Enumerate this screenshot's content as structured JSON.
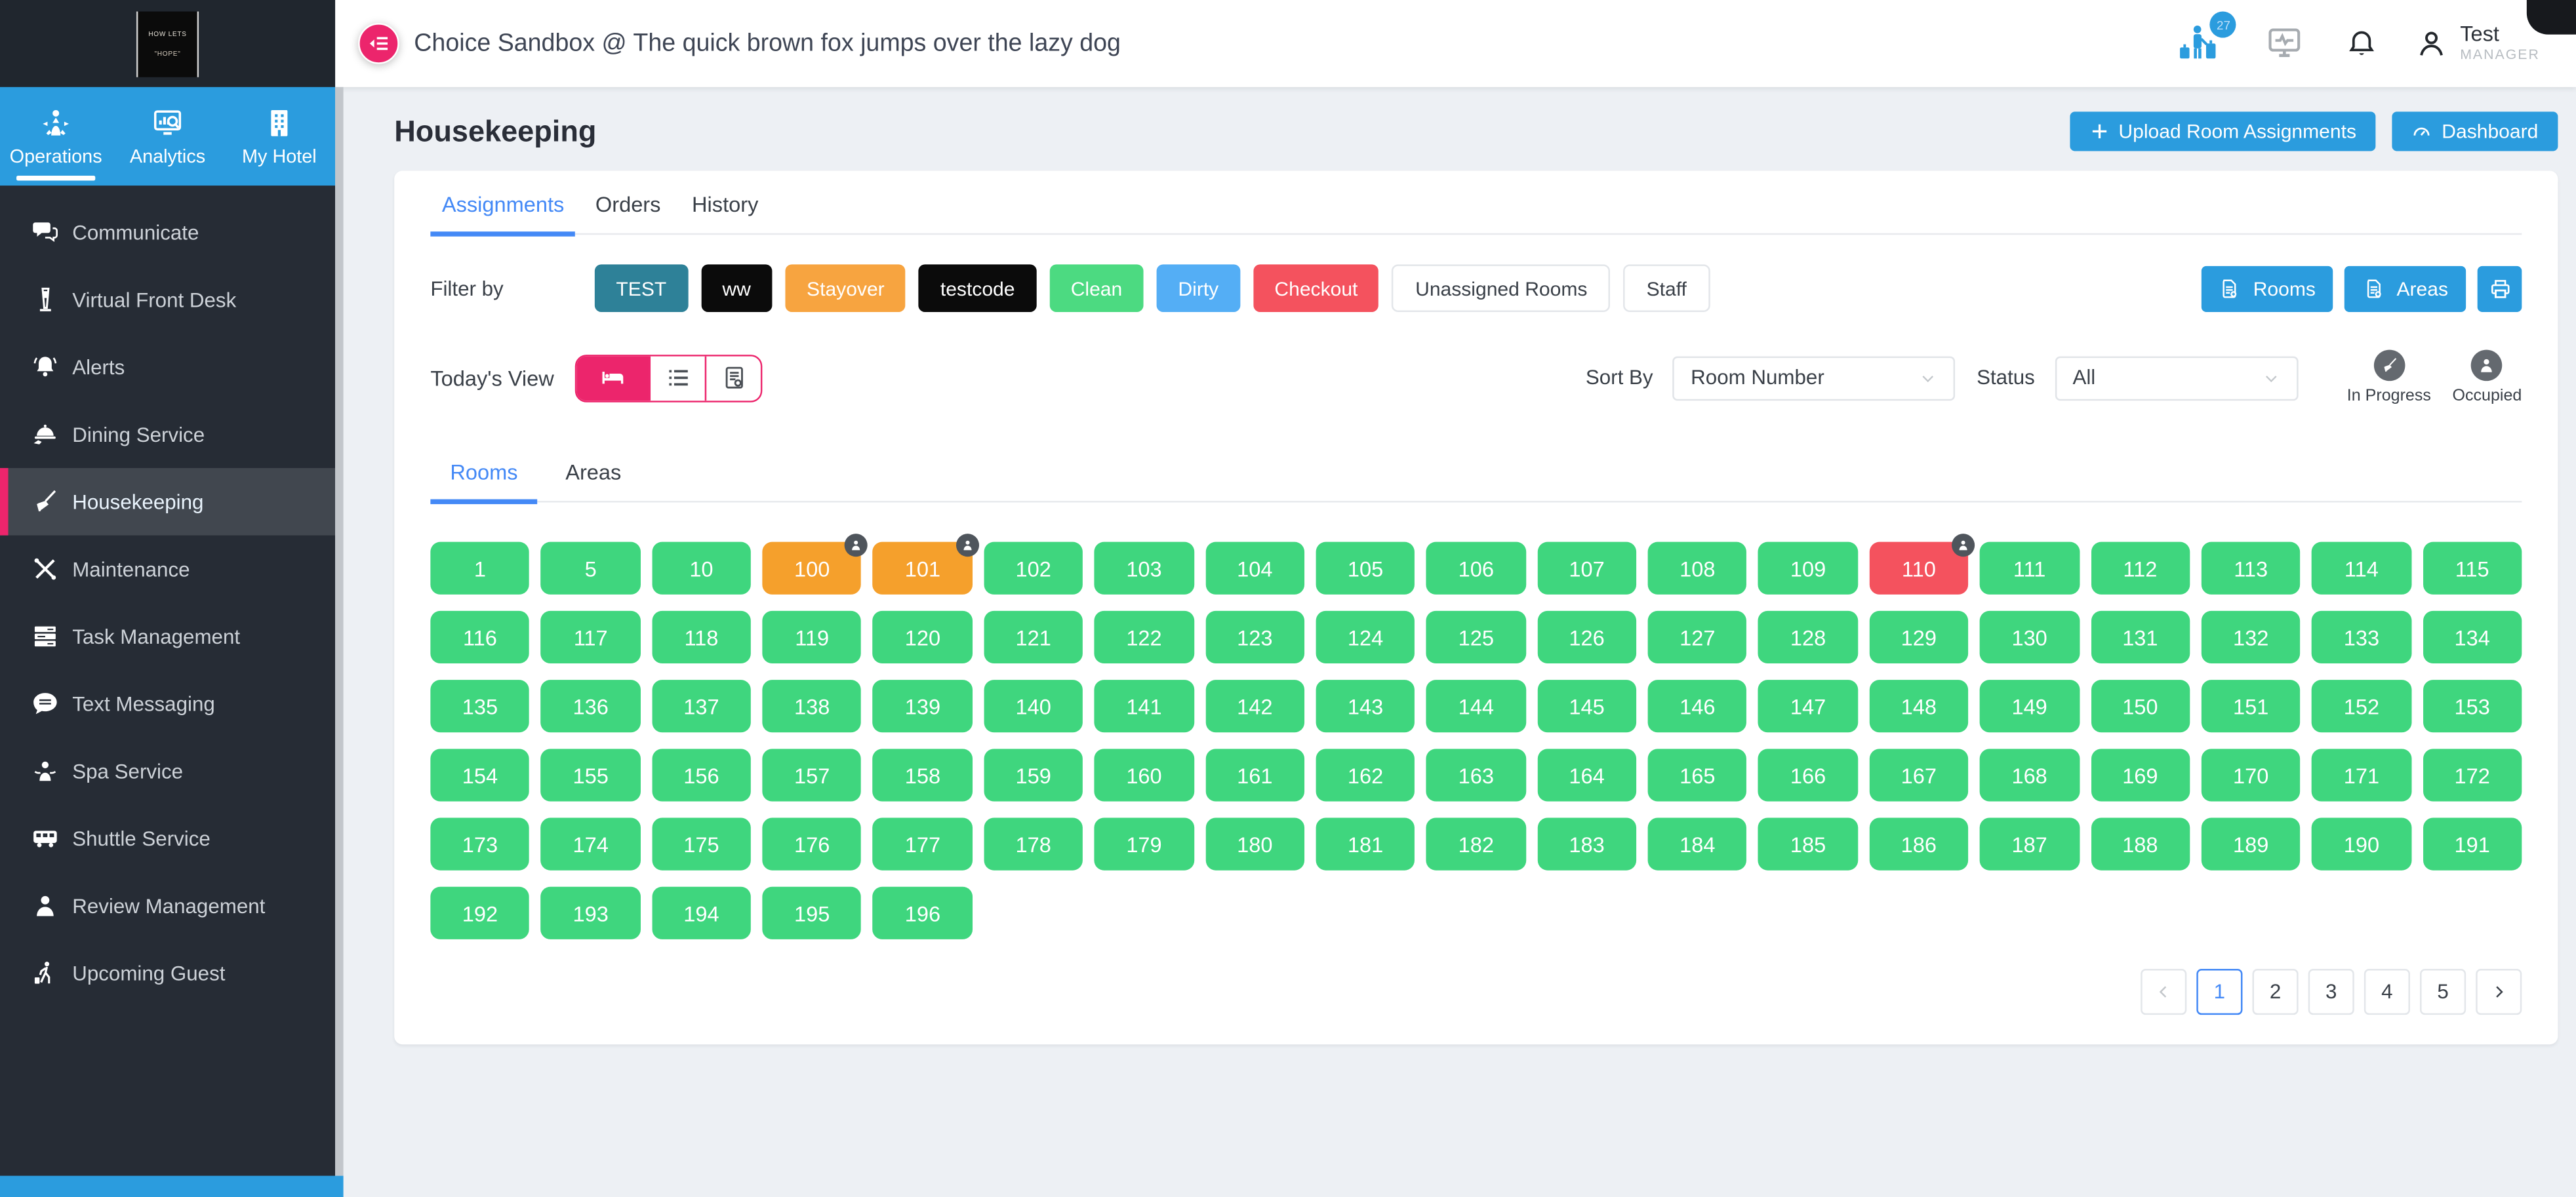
{
  "header": {
    "logo_line1": "HOW LETS",
    "logo_line2": "\"HOPE\"",
    "title": "Choice Sandbox @ The quick brown fox jumps over the lazy dog",
    "guest_badge": "27",
    "user_name": "Test",
    "user_role": "MANAGER"
  },
  "sidebar": {
    "tabs": [
      {
        "label": "Operations",
        "icon": "operations",
        "active": true
      },
      {
        "label": "Analytics",
        "icon": "analytics",
        "active": false
      },
      {
        "label": "My Hotel",
        "icon": "hotel",
        "active": false
      }
    ],
    "items": [
      {
        "label": "Communicate",
        "icon": "chat",
        "active": false
      },
      {
        "label": "Virtual Front Desk",
        "icon": "kiosk",
        "active": false
      },
      {
        "label": "Alerts",
        "icon": "bellring",
        "active": false
      },
      {
        "label": "Dining Service",
        "icon": "dining",
        "active": false
      },
      {
        "label": "Housekeeping",
        "icon": "broom",
        "active": true
      },
      {
        "label": "Maintenance",
        "icon": "tools",
        "active": false
      },
      {
        "label": "Task Management",
        "icon": "tasks",
        "active": false
      },
      {
        "label": "Text Messaging",
        "icon": "message",
        "active": false
      },
      {
        "label": "Spa Service",
        "icon": "spa",
        "active": false
      },
      {
        "label": "Shuttle Service",
        "icon": "bus",
        "active": false
      },
      {
        "label": "Review Management",
        "icon": "person",
        "active": false
      },
      {
        "label": "Upcoming Guest",
        "icon": "walker",
        "active": false
      }
    ]
  },
  "page": {
    "title": "Housekeeping",
    "upload_button": "Upload Room Assignments",
    "dashboard_button": "Dashboard"
  },
  "main_tabs": [
    {
      "label": "Assignments",
      "active": true
    },
    {
      "label": "Orders",
      "active": false
    },
    {
      "label": "History",
      "active": false
    }
  ],
  "filter": {
    "label": "Filter by",
    "chips": [
      {
        "label": "TEST",
        "bg": "#2E8198",
        "fg": "#FFFFFF"
      },
      {
        "label": "ww",
        "bg": "#0B0B0B",
        "fg": "#FFFFFF"
      },
      {
        "label": "Stayover",
        "bg": "#F7A440",
        "fg": "#FFFFFF"
      },
      {
        "label": "testcode",
        "bg": "#0B0B0B",
        "fg": "#FFFFFF"
      },
      {
        "label": "Clean",
        "bg": "#4CDA81",
        "fg": "#FFFFFF"
      },
      {
        "label": "Dirty",
        "bg": "#54AEF5",
        "fg": "#FFFFFF"
      },
      {
        "label": "Checkout",
        "bg": "#F4525E",
        "fg": "#FFFFFF"
      },
      {
        "label": "Unassigned Rooms",
        "bg": "#FFFFFF",
        "fg": "#3A4048"
      },
      {
        "label": "Staff",
        "bg": "#FFFFFF",
        "fg": "#3A4048"
      }
    ],
    "rooms_button": "Rooms",
    "areas_button": "Areas"
  },
  "toolbar": {
    "view_label": "Today's View",
    "sort_label": "Sort By",
    "sort_value": "Room Number",
    "status_label": "Status",
    "status_value": "All",
    "legend": [
      {
        "label": "In Progress",
        "icon": "broom"
      },
      {
        "label": "Occupied",
        "icon": "person"
      }
    ]
  },
  "sub_tabs": [
    {
      "label": "Rooms",
      "active": true
    },
    {
      "label": "Areas",
      "active": false
    }
  ],
  "status_colors": {
    "clean": "#3FD67E",
    "stayover": "#F5A02C",
    "checkout": "#F4525E"
  },
  "rooms": [
    [
      "1",
      "clean",
      0
    ],
    [
      "5",
      "clean",
      0
    ],
    [
      "10",
      "clean",
      0
    ],
    [
      "100",
      "stayover",
      1
    ],
    [
      "101",
      "stayover",
      1
    ],
    [
      "102",
      "clean",
      0
    ],
    [
      "103",
      "clean",
      0
    ],
    [
      "104",
      "clean",
      0
    ],
    [
      "105",
      "clean",
      0
    ],
    [
      "106",
      "clean",
      0
    ],
    [
      "107",
      "clean",
      0
    ],
    [
      "108",
      "clean",
      0
    ],
    [
      "109",
      "clean",
      0
    ],
    [
      "110",
      "checkout",
      1
    ],
    [
      "111",
      "clean",
      0
    ],
    [
      "112",
      "clean",
      0
    ],
    [
      "113",
      "clean",
      0
    ],
    [
      "114",
      "clean",
      0
    ],
    [
      "115",
      "clean",
      0
    ],
    [
      "116",
      "clean",
      0
    ],
    [
      "117",
      "clean",
      0
    ],
    [
      "118",
      "clean",
      0
    ],
    [
      "119",
      "clean",
      0
    ],
    [
      "120",
      "clean",
      0
    ],
    [
      "121",
      "clean",
      0
    ],
    [
      "122",
      "clean",
      0
    ],
    [
      "123",
      "clean",
      0
    ],
    [
      "124",
      "clean",
      0
    ],
    [
      "125",
      "clean",
      0
    ],
    [
      "126",
      "clean",
      0
    ],
    [
      "127",
      "clean",
      0
    ],
    [
      "128",
      "clean",
      0
    ],
    [
      "129",
      "clean",
      0
    ],
    [
      "130",
      "clean",
      0
    ],
    [
      "131",
      "clean",
      0
    ],
    [
      "132",
      "clean",
      0
    ],
    [
      "133",
      "clean",
      0
    ],
    [
      "134",
      "clean",
      0
    ],
    [
      "135",
      "clean",
      0
    ],
    [
      "136",
      "clean",
      0
    ],
    [
      "137",
      "clean",
      0
    ],
    [
      "138",
      "clean",
      0
    ],
    [
      "139",
      "clean",
      0
    ],
    [
      "140",
      "clean",
      0
    ],
    [
      "141",
      "clean",
      0
    ],
    [
      "142",
      "clean",
      0
    ],
    [
      "143",
      "clean",
      0
    ],
    [
      "144",
      "clean",
      0
    ],
    [
      "145",
      "clean",
      0
    ],
    [
      "146",
      "clean",
      0
    ],
    [
      "147",
      "clean",
      0
    ],
    [
      "148",
      "clean",
      0
    ],
    [
      "149",
      "clean",
      0
    ],
    [
      "150",
      "clean",
      0
    ],
    [
      "151",
      "clean",
      0
    ],
    [
      "152",
      "clean",
      0
    ],
    [
      "153",
      "clean",
      0
    ],
    [
      "154",
      "clean",
      0
    ],
    [
      "155",
      "clean",
      0
    ],
    [
      "156",
      "clean",
      0
    ],
    [
      "157",
      "clean",
      0
    ],
    [
      "158",
      "clean",
      0
    ],
    [
      "159",
      "clean",
      0
    ],
    [
      "160",
      "clean",
      0
    ],
    [
      "161",
      "clean",
      0
    ],
    [
      "162",
      "clean",
      0
    ],
    [
      "163",
      "clean",
      0
    ],
    [
      "164",
      "clean",
      0
    ],
    [
      "165",
      "clean",
      0
    ],
    [
      "166",
      "clean",
      0
    ],
    [
      "167",
      "clean",
      0
    ],
    [
      "168",
      "clean",
      0
    ],
    [
      "169",
      "clean",
      0
    ],
    [
      "170",
      "clean",
      0
    ],
    [
      "171",
      "clean",
      0
    ],
    [
      "172",
      "clean",
      0
    ],
    [
      "173",
      "clean",
      0
    ],
    [
      "174",
      "clean",
      0
    ],
    [
      "175",
      "clean",
      0
    ],
    [
      "176",
      "clean",
      0
    ],
    [
      "177",
      "clean",
      0
    ],
    [
      "178",
      "clean",
      0
    ],
    [
      "179",
      "clean",
      0
    ],
    [
      "180",
      "clean",
      0
    ],
    [
      "181",
      "clean",
      0
    ],
    [
      "182",
      "clean",
      0
    ],
    [
      "183",
      "clean",
      0
    ],
    [
      "184",
      "clean",
      0
    ],
    [
      "185",
      "clean",
      0
    ],
    [
      "186",
      "clean",
      0
    ],
    [
      "187",
      "clean",
      0
    ],
    [
      "188",
      "clean",
      0
    ],
    [
      "189",
      "clean",
      0
    ],
    [
      "190",
      "clean",
      0
    ],
    [
      "191",
      "clean",
      0
    ],
    [
      "192",
      "clean",
      0
    ],
    [
      "193",
      "clean",
      0
    ],
    [
      "194",
      "clean",
      0
    ],
    [
      "195",
      "clean",
      0
    ],
    [
      "196",
      "clean",
      0
    ]
  ],
  "pagination": {
    "pages": [
      "1",
      "2",
      "3",
      "4",
      "5"
    ],
    "active": "1"
  }
}
